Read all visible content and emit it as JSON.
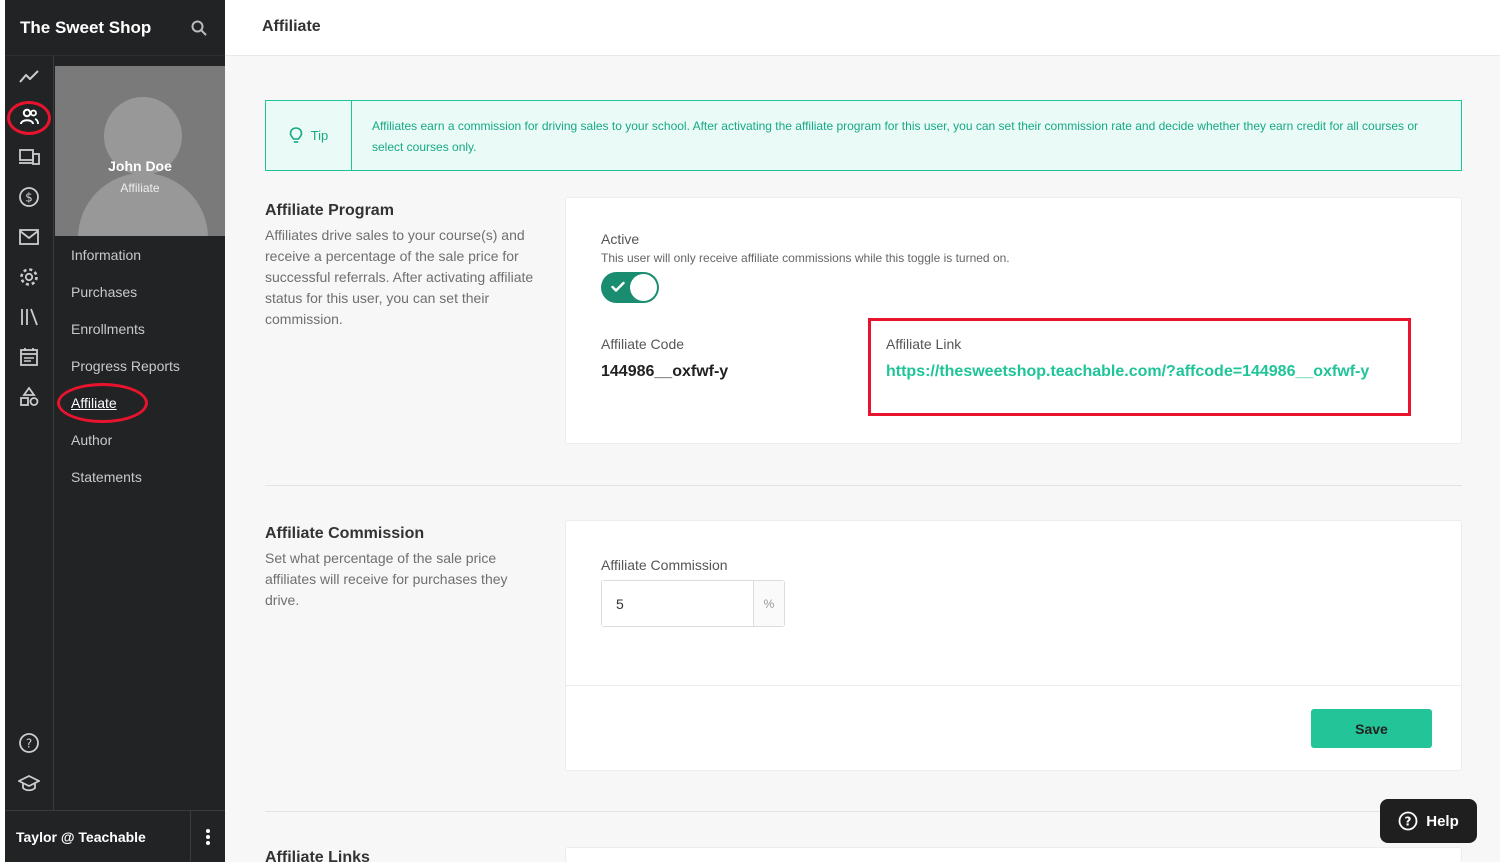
{
  "sidebar": {
    "brand": "The Sweet Shop",
    "rail_icons": [
      "trend-icon",
      "users-icon",
      "devices-icon",
      "dollar-icon",
      "mail-icon",
      "gear-icon",
      "library-icon",
      "calendar-icon",
      "shapes-icon",
      "help-circle-icon",
      "graduation-icon"
    ],
    "profile": {
      "name": "John Doe",
      "role": "Affiliate"
    },
    "nav": [
      "Information",
      "Purchases",
      "Enrollments",
      "Progress Reports",
      "Affiliate",
      "Author",
      "Statements"
    ],
    "active_nav": "Affiliate",
    "footer_user": "Taylor @ Teachable"
  },
  "header": {
    "title": "Affiliate"
  },
  "tip": {
    "label": "Tip",
    "text": "Affiliates earn a commission for driving sales to your school. After activating the affiliate program for this user, you can set their commission rate and decide whether they earn credit for all courses or select courses only."
  },
  "program": {
    "title": "Affiliate Program",
    "description": "Affiliates drive sales to your course(s) and receive a percentage of the sale price for successful referrals. After activating affiliate status for this user, you can set their commission.",
    "active_label": "Active",
    "active_hint": "This user will only receive affiliate commissions while this toggle is turned on.",
    "active": true,
    "code_label": "Affiliate Code",
    "code": "144986__oxfwf-y",
    "link_label": "Affiliate Link",
    "link": "https://thesweetshop.teachable.com/?affcode=144986__oxfwf-y"
  },
  "commission": {
    "title": "Affiliate Commission",
    "description": "Set what percentage of the sale price affiliates will receive for purchases they drive.",
    "field_label": "Affiliate Commission",
    "value": "5",
    "suffix": "%",
    "save_label": "Save"
  },
  "links": {
    "title": "Affiliate Links"
  },
  "help": {
    "label": "Help"
  },
  "colors": {
    "accent": "#22c498",
    "sidebar": "#222325",
    "highlight": "#e8142e"
  }
}
